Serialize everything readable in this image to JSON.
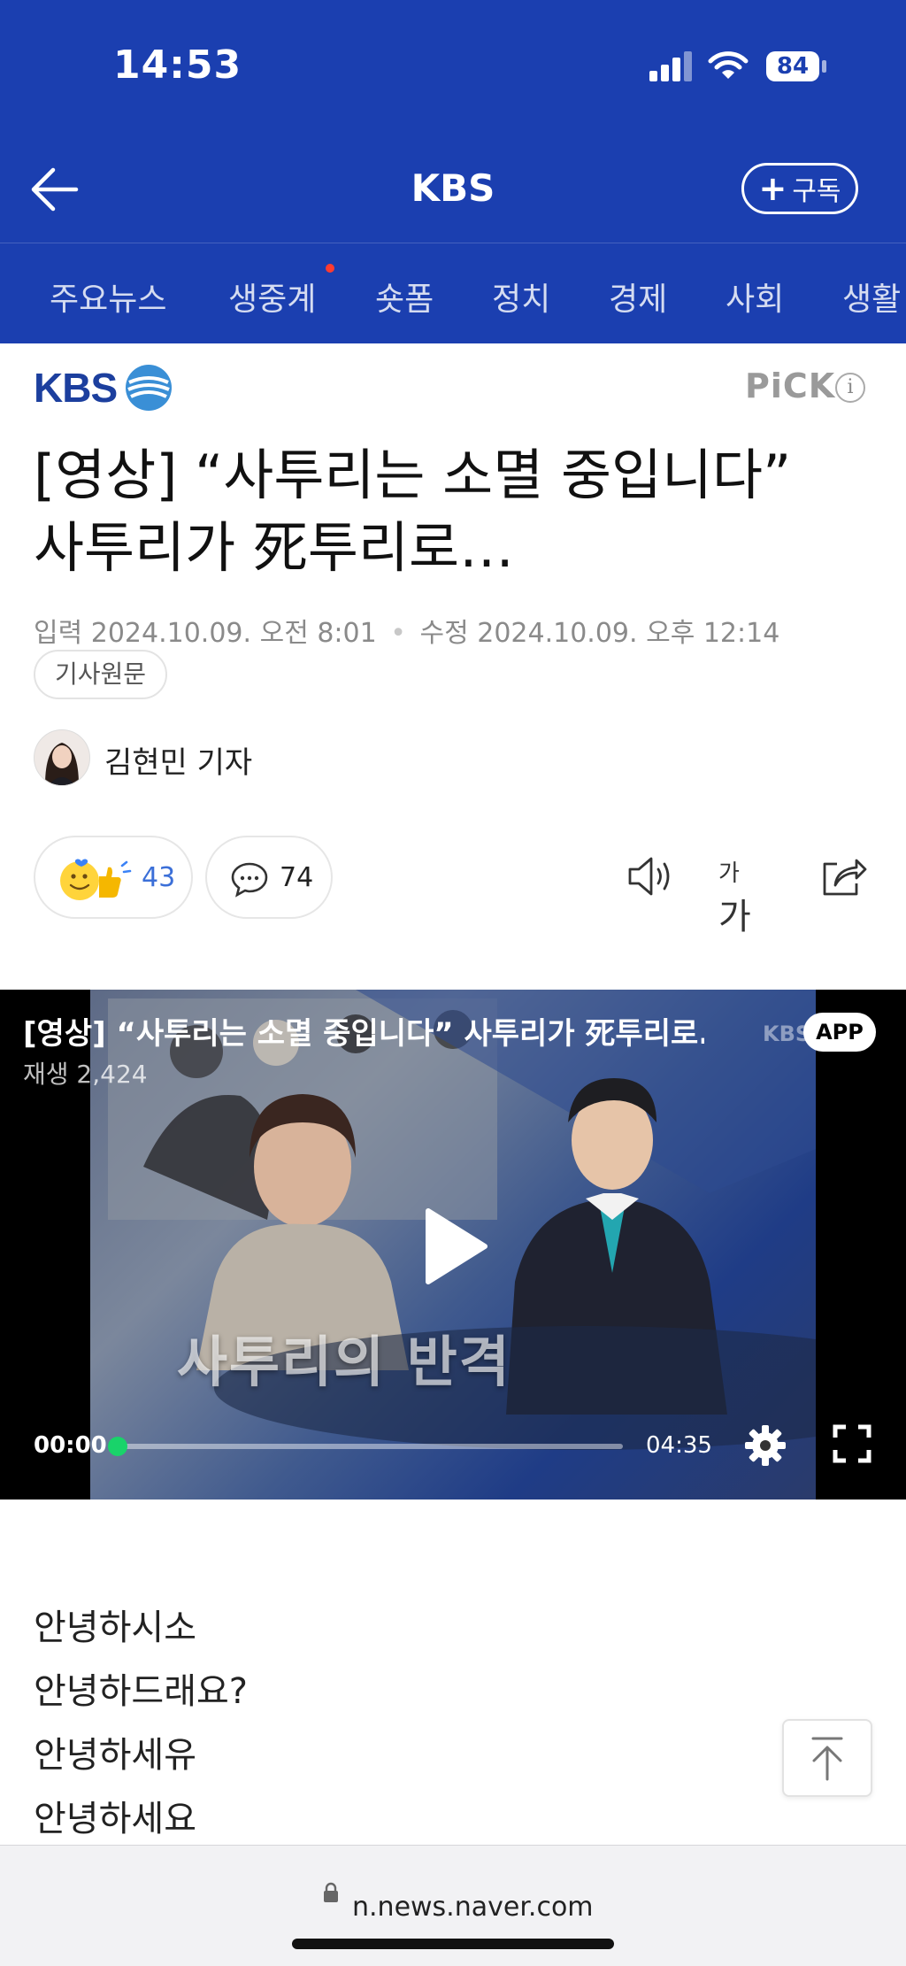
{
  "status_bar": {
    "time": "14:53",
    "battery": "84"
  },
  "nav": {
    "title": "KBS",
    "subscribe_label": "구독"
  },
  "tabs": [
    "주요뉴스",
    "생중계",
    "숏폼",
    "정치",
    "경제",
    "사회",
    "생활"
  ],
  "article": {
    "press_logo_text": "KBS",
    "pick_label": "PiCK",
    "pick_info": "i",
    "headline_line1": "[영상] “사투리는 소멸 중입니다”",
    "headline_line2": "사투리가 死투리로…",
    "input_label": "입력",
    "input_date": "2024.10.09. 오전 8:01",
    "edit_label": "수정",
    "edit_date": "2024.10.09. 오후 12:14",
    "original_label": "기사원문",
    "reporter": "김현민 기자",
    "reaction_count": "43",
    "comment_count": "74",
    "font_small": "가",
    "font_big": "가"
  },
  "video": {
    "title": "[영상] “사투리는 소멸 중입니다” 사투리가 死투리로...",
    "views": "재생 2,424",
    "watermark": "KBS",
    "app_badge": "APP",
    "caption": "사투리의 반격",
    "current_time": "00:00",
    "duration": "04:35",
    "progress": 0
  },
  "body_lines": [
    "안녕하시소",
    "안녕하드래요?",
    "안녕하세유",
    "안녕하세요"
  ],
  "browser": {
    "url": "n.news.naver.com"
  },
  "colors": {
    "brand_blue": "#1b3fb0",
    "progress_green": "#19d36a",
    "reaction_blue": "#3b6fd8"
  }
}
